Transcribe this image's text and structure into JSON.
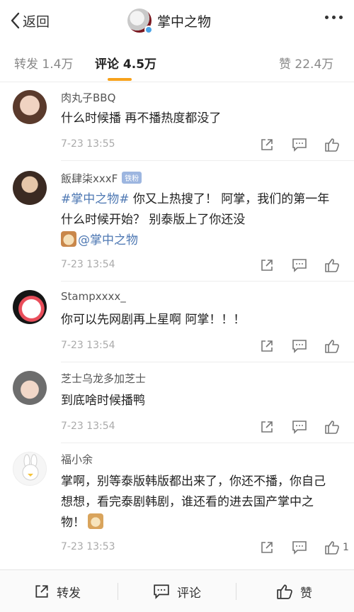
{
  "header": {
    "back_label": "返回",
    "title": "掌中之物"
  },
  "tabs": [
    {
      "label": "转发 1.4万"
    },
    {
      "label": "评论 4.5万"
    },
    {
      "label": "赞 22.4万"
    }
  ],
  "comments": [
    {
      "user": "肉丸子BBQ",
      "text": "什么时候播 再不播热度都没了",
      "time": "7-23 13:55",
      "likes": ""
    },
    {
      "user": "飯肆柒xxxF",
      "badge": "铁粉",
      "text_link1": "#掌中之物#",
      "text_mid": " 你又上热搜了！ 阿掌，我们的第一年什么时候开始？ 别泰版上了你还没",
      "text_link2": "@掌中之物",
      "time": "7-23 13:54",
      "likes": ""
    },
    {
      "user": "Stampxxxx_",
      "text": "你可以先网剧再上星啊 阿掌！！！",
      "time": "7-23 13:54",
      "likes": ""
    },
    {
      "user": "芝士乌龙多加芝士",
      "text": "到底啥时候播鸭",
      "time": "7-23 13:54",
      "likes": ""
    },
    {
      "user": "福小余",
      "text": "掌啊，别等泰版韩版都出来了，你还不播，你自己想想，看完泰剧韩剧，谁还看的进去国产掌中之物！",
      "time": "7-23 13:53",
      "likes": "1"
    }
  ],
  "bottom": {
    "repost": "转发",
    "comment": "评论",
    "like": "赞"
  },
  "colors": {
    "accent": "#f7a21c",
    "link": "#4e78b3"
  }
}
